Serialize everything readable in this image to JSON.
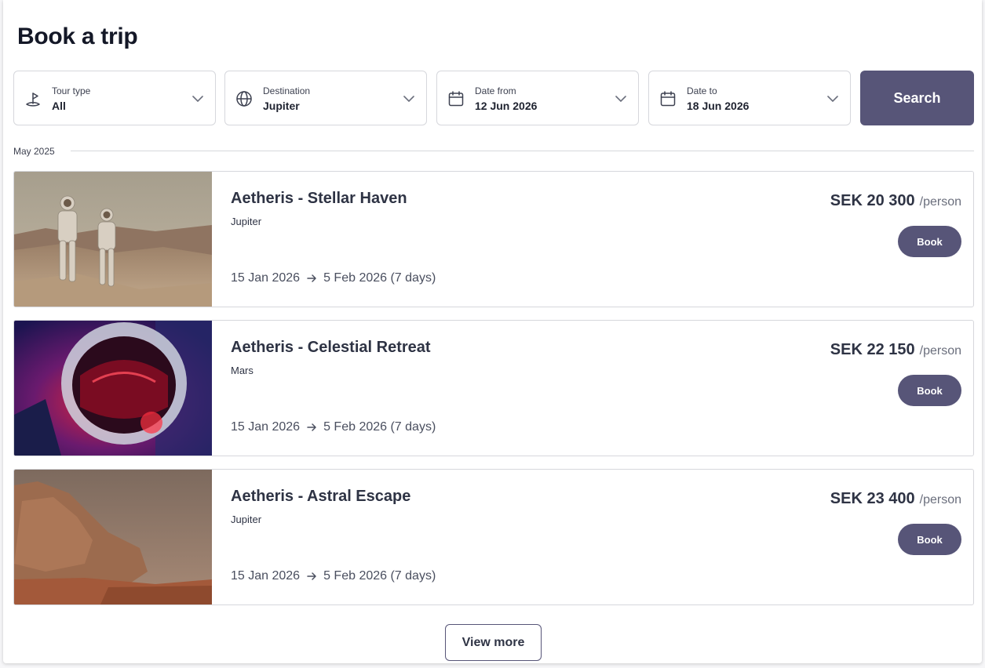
{
  "page": {
    "title": "Book a trip"
  },
  "filters": [
    {
      "label": "Tour type",
      "value": "All",
      "icon": "tour-type-icon"
    },
    {
      "label": "Destination",
      "value": "Jupiter",
      "icon": "globe-icon"
    },
    {
      "label": "Date from",
      "value": "12 Jun 2026",
      "icon": "calendar-icon"
    },
    {
      "label": "Date to",
      "value": "18 Jun 2026",
      "icon": "calendar-icon"
    }
  ],
  "search": {
    "label": "Search"
  },
  "section": {
    "label": "May 2025"
  },
  "trips": [
    {
      "name": "Aetheris - Stellar Haven",
      "destination": "Jupiter",
      "date_from": "15 Jan 2026",
      "date_to": "5 Feb 2026 (7 days)",
      "price": "SEK 20 300",
      "price_unit": "/person",
      "book_label": "Book",
      "image": "astronauts-on-desert-image"
    },
    {
      "name": "Aetheris - Celestial Retreat",
      "destination": "Mars",
      "date_from": "15 Jan 2026",
      "date_to": "5 Feb 2026 (7 days)",
      "price": "SEK 22 150",
      "price_unit": "/person",
      "book_label": "Book",
      "image": "astronaut-helmet-red-light-image"
    },
    {
      "name": "Aetheris - Astral Escape",
      "destination": "Jupiter",
      "date_from": "15 Jan 2026",
      "date_to": "5 Feb 2026 (7 days)",
      "price": "SEK 23 400",
      "price_unit": "/person",
      "book_label": "Book",
      "image": "red-rock-landscape-image"
    }
  ],
  "view_more": {
    "label": "View more"
  },
  "colors": {
    "accent": "#575578",
    "border": "#d6d7dc",
    "text": "#2e3344"
  }
}
